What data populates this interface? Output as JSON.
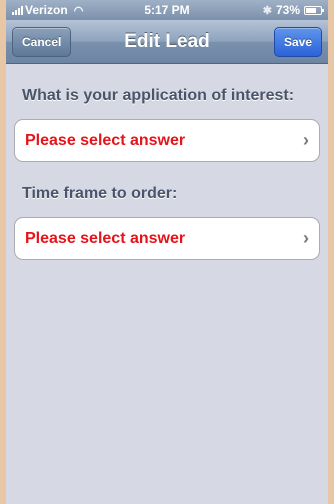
{
  "status_bar": {
    "carrier": "Verizon",
    "time": "5:17 PM",
    "battery_percent": "73%",
    "battery_level": 0.73
  },
  "nav_bar": {
    "cancel_label": "Cancel",
    "title": "Edit Lead",
    "save_label": "Save"
  },
  "form": {
    "questions": [
      {
        "label": "What is your application of interest:",
        "answer": "Please select answer"
      },
      {
        "label": "Time frame to order:",
        "answer": "Please select answer"
      }
    ]
  },
  "colors": {
    "answer_placeholder": "#e5141a",
    "save_button": "#2b63d8",
    "background": "#d6d9e3"
  }
}
